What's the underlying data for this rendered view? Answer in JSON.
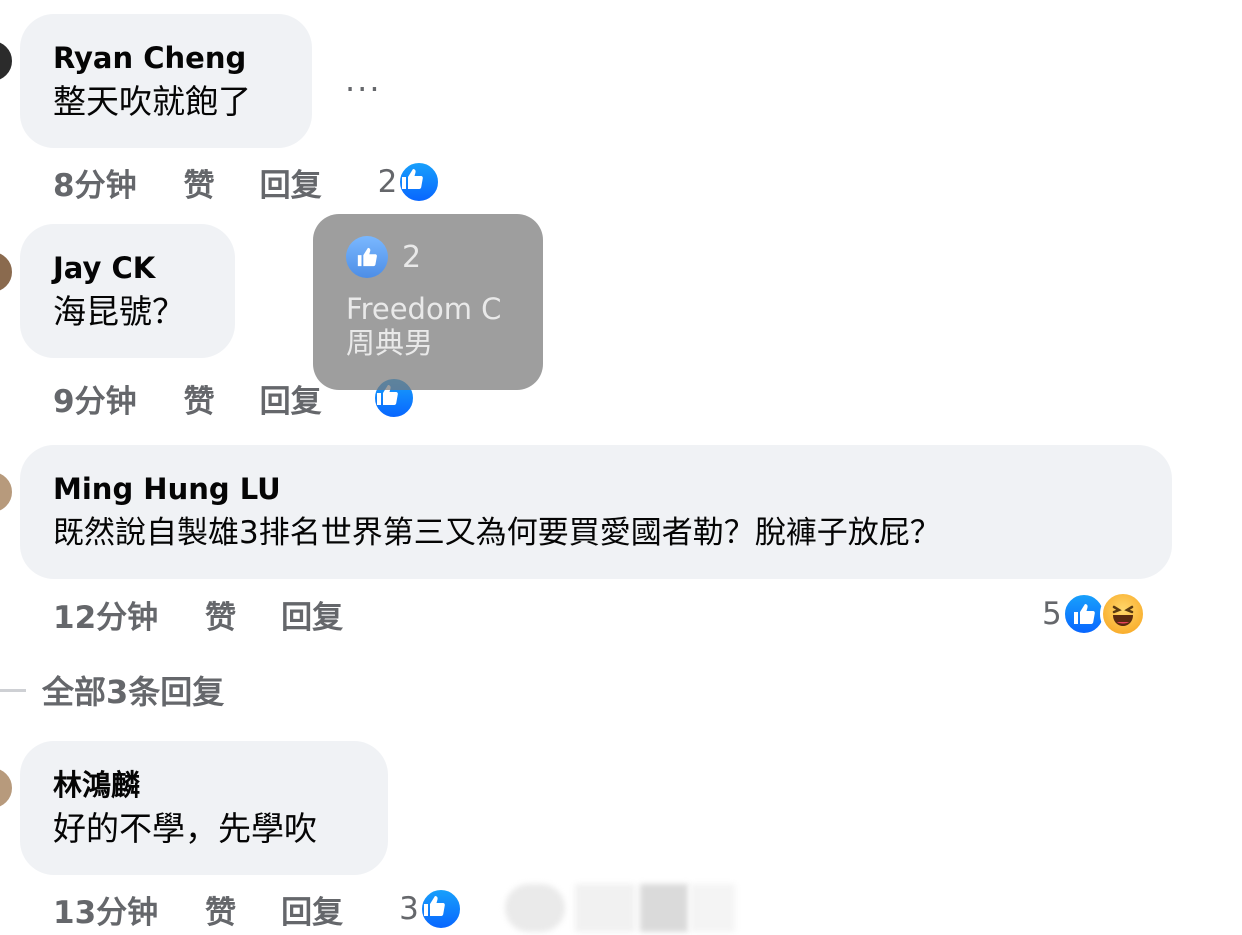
{
  "comments": [
    {
      "author": "Ryan Cheng",
      "text": "整天吹就飽了",
      "time": "8分钟",
      "like": "赞",
      "reply": "回复",
      "reactions": "2"
    },
    {
      "author": "Jay CK",
      "text": "海昆號？",
      "time": "9分钟",
      "like": "赞",
      "reply": "回复",
      "reactions": ""
    },
    {
      "author": "Ming Hung LU",
      "text": "既然說自製雄3排名世界第三又為何要買愛國者勒？脫褲子放屁？",
      "time": "12分钟",
      "like": "赞",
      "reply": "回复",
      "reactions": "5"
    },
    {
      "author": "林鴻麟",
      "text": "好的不學，先學吹",
      "time": "13分钟",
      "like": "赞",
      "reply": "回复",
      "reactions": "3"
    }
  ],
  "more_menu": "···",
  "tooltip": {
    "count": "2",
    "names": [
      "Freedom C",
      "周典男"
    ]
  },
  "view_replies": "全部3条回复",
  "colors": {
    "like_blue": "#0866ff",
    "bubble": "#f0f2f5",
    "meta_gray": "#65676b"
  },
  "icons": {
    "like": "like-thumb-icon",
    "haha": "haha-emoji-icon"
  }
}
